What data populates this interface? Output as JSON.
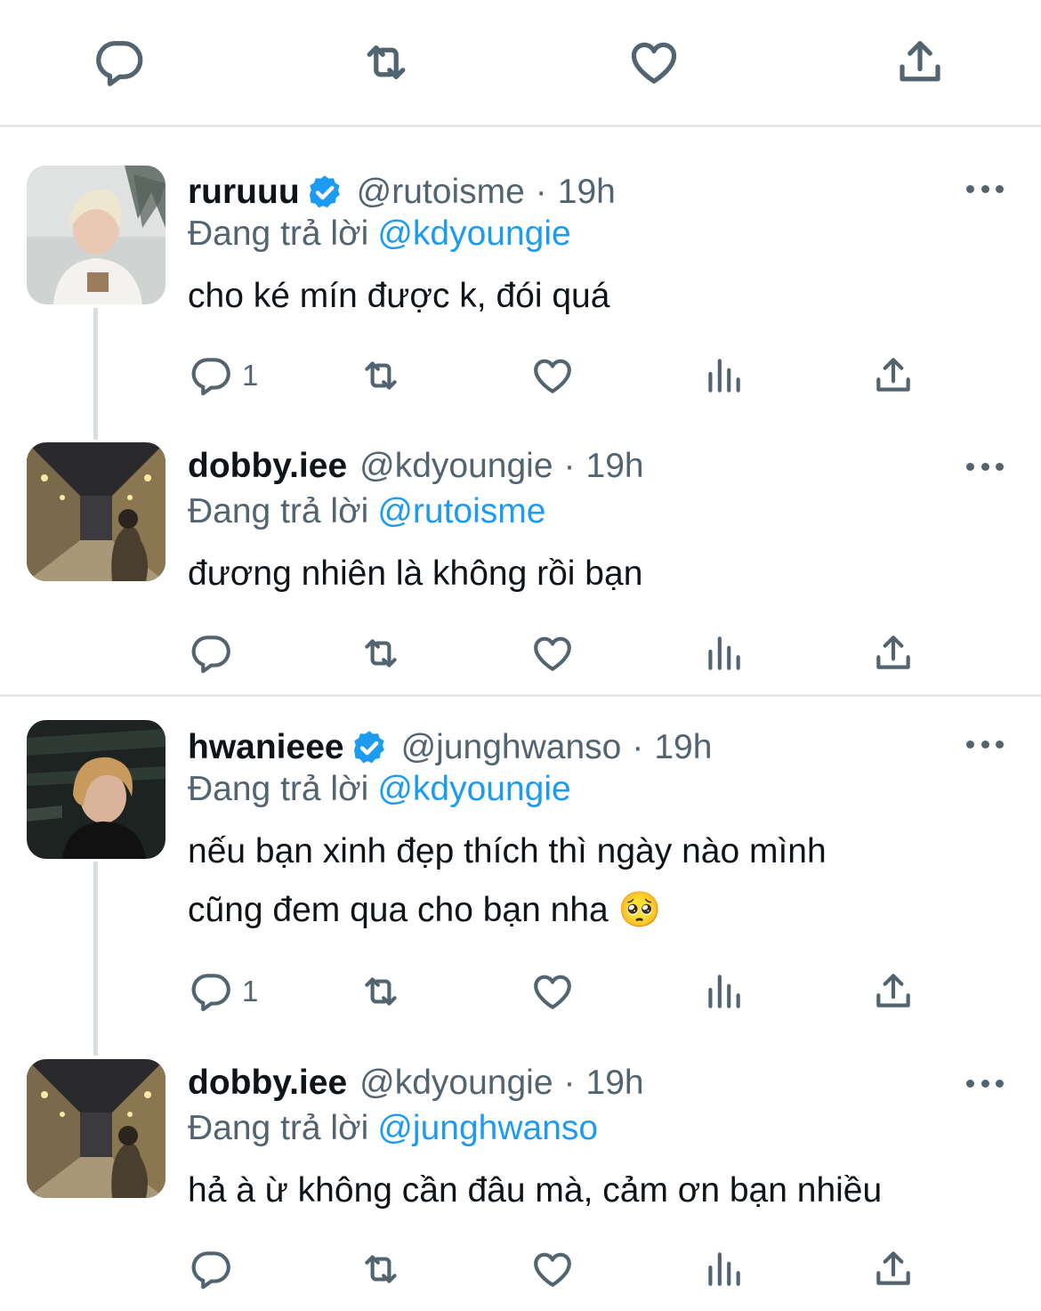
{
  "top_actions": [
    {
      "icon": "reply-icon"
    },
    {
      "icon": "retweet-icon"
    },
    {
      "icon": "like-icon"
    },
    {
      "icon": "share-icon"
    }
  ],
  "reply_prefix": "Đang trả lời",
  "colors": {
    "link": "#1d9bf0",
    "muted": "#536471",
    "verified": "#1d9bf0",
    "text": "#0f1419"
  },
  "tweets": [
    {
      "name": "ruruuu",
      "verified": true,
      "handle": "@rutoisme",
      "dot": "·",
      "time": "19h",
      "reply_to": "@kdyoungie",
      "text_lines": [
        "cho ké mín được k, đói quá"
      ],
      "reply_count": "1",
      "avatar": "blonde-guy-photo"
    },
    {
      "name": "dobby.iee",
      "verified": false,
      "handle": "@kdyoungie",
      "dot": "·",
      "time": "19h",
      "reply_to": "@rutoisme",
      "text_lines": [
        "đương nhiên là không rồi bạn"
      ],
      "reply_count": "",
      "avatar": "night-street-photo"
    },
    {
      "name": "hwanieee",
      "verified": true,
      "handle": "@junghwanso",
      "dot": "·",
      "time": "19h",
      "reply_to": "@kdyoungie",
      "text_lines": [
        "nếu bạn xinh đẹp thích thì ngày nào mình",
        "cũng đem qua cho bạn nha 🥺"
      ],
      "reply_count": "1",
      "avatar": "dark-portrait-photo"
    },
    {
      "name": "dobby.iee",
      "verified": false,
      "handle": "@kdyoungie",
      "dot": "·",
      "time": "19h",
      "reply_to": "@junghwanso",
      "text_lines": [
        "hả à ừ không cần đâu mà, cảm ơn bạn nhiều"
      ],
      "reply_count": "",
      "avatar": "night-street-photo"
    }
  ]
}
